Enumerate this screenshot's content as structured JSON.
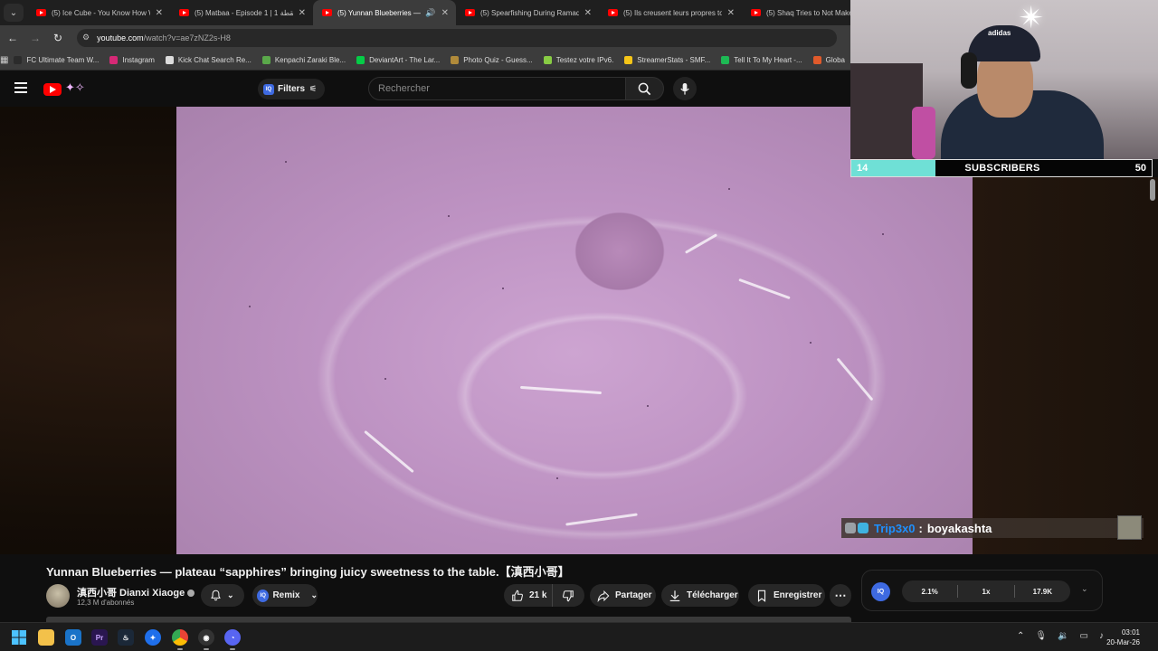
{
  "browser": {
    "tabs": [
      {
        "title": "(5) Ice Cube - You Know How W",
        "active": false
      },
      {
        "title": "(5) Matbaa - Episode 1 | 1 لقطة",
        "active": false
      },
      {
        "title": "(5) Yunnan Blueberries — p",
        "active": true
      },
      {
        "title": "(5) Spearfishing During Ramad",
        "active": false
      },
      {
        "title": "(5) Ils creusent leurs propres to",
        "active": false
      },
      {
        "title": "(5) Shaq Tries to Not Make a",
        "active": false
      }
    ],
    "url_host": "youtube.com",
    "url_path": "/watch?v=ae7zNZ2s-H8",
    "bookmarks": [
      {
        "label": "FC Ultimate Team W...",
        "color": "#2b2b2b"
      },
      {
        "label": "Instagram",
        "color": "#d62976"
      },
      {
        "label": "Kick Chat Search Re...",
        "color": "#dddddd"
      },
      {
        "label": "Kenpachi Zaraki Ble...",
        "color": "#5aa84a"
      },
      {
        "label": "DeviantArt - The Lar...",
        "color": "#05cc47"
      },
      {
        "label": "Photo Quiz - Guess...",
        "color": "#b08a3a"
      },
      {
        "label": "Testez votre IPv6.",
        "color": "#88cc44"
      },
      {
        "label": "StreamerStats - SMF...",
        "color": "#f5c518"
      },
      {
        "label": "Tell It To My Heart -...",
        "color": "#1db954"
      },
      {
        "label": "Globa",
        "color": "#e05a2b"
      }
    ]
  },
  "youtube": {
    "filters_label": "Filters",
    "search_placeholder": "Rechercher",
    "video": {
      "title": "Yunnan Blueberries — plateau “sapphires” bringing juicy sweetness to the table.【滇西小哥】",
      "channel": "滇西小哥 Dianxi Xiaoge",
      "subscribers": "12,3 M d'abonnés",
      "likes": "21 k"
    },
    "actions": {
      "remix": "Remix",
      "share": "Partager",
      "download": "Télécharger",
      "save": "Enregistrer",
      "more": "⋯"
    },
    "extension": {
      "logo": "IQ",
      "stat_1": "2.1%",
      "stat_2": "1x",
      "stat_3": "17.9K"
    }
  },
  "overlay": {
    "sub_goal_current": "14",
    "sub_goal_label": "SUBSCRIBERS",
    "sub_goal_target": "50",
    "sub_goal_progress": 0.28,
    "chat": {
      "user": "Trip3x0",
      "message": "boyakashta"
    },
    "cap_logo": "adidas"
  },
  "taskbar": {
    "time": "03:01",
    "date": "20-Mar-26"
  },
  "colors": {
    "youtube_red": "#ff0000",
    "sub_goal_fill": "#6fe0d6",
    "chat_username": "#1e90ff",
    "extension_accent": "#3e6ae1"
  }
}
